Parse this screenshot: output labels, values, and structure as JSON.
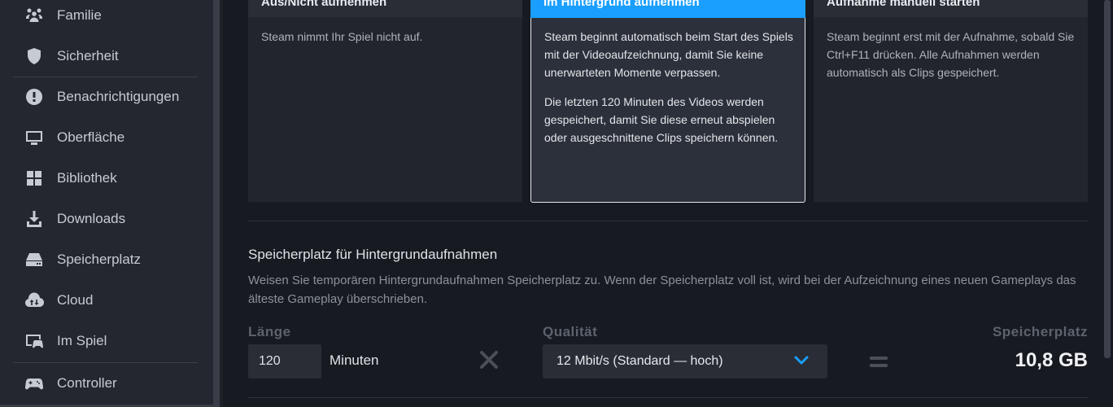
{
  "sidebar": {
    "items": [
      {
        "label": "Familie",
        "icon": "family-icon"
      },
      {
        "label": "Sicherheit",
        "icon": "shield-icon"
      },
      {
        "label": "Benachrichtigungen",
        "icon": "notification-icon"
      },
      {
        "label": "Oberfläche",
        "icon": "monitor-icon"
      },
      {
        "label": "Bibliothek",
        "icon": "library-grid-icon"
      },
      {
        "label": "Downloads",
        "icon": "download-icon"
      },
      {
        "label": "Speicherplatz",
        "icon": "storage-drive-icon"
      },
      {
        "label": "Cloud",
        "icon": "cloud-sync-icon"
      },
      {
        "label": "Im Spiel",
        "icon": "in-game-icon"
      },
      {
        "label": "Controller",
        "icon": "gamepad-icon"
      }
    ]
  },
  "recording_modes": [
    {
      "title": "Aus/Nicht aufnehmen",
      "paragraphs": [
        "Steam nimmt Ihr Spiel nicht auf."
      ],
      "selected": false
    },
    {
      "title": "Im Hintergrund aufnehmen",
      "paragraphs": [
        "Steam beginnt automatisch beim Start des Spiels mit der Videoaufzeichnung, damit Sie keine unerwarteten Momente verpassen.",
        "Die letzten 120 Minuten des Videos werden gespeichert, damit Sie diese erneut abspielen oder ausgeschnittene Clips speichern können."
      ],
      "selected": true
    },
    {
      "title": "Aufnahme manuell starten",
      "paragraphs": [
        "Steam beginnt erst mit der Aufnahme, sobald Sie Ctrl+F11 drücken. Alle Aufnahmen werden automatisch als Clips gespeichert."
      ],
      "selected": false
    }
  ],
  "background_storage": {
    "title": "Speicherplatz für Hintergrundaufnahmen",
    "description": "Weisen Sie temporären Hintergrundaufnahmen Speicherplatz zu. Wenn der Speicherplatz voll ist, wird bei der Aufzeichnung eines neuen Gameplays das älteste Gameplay überschrieben.",
    "length_label": "Länge",
    "length_value": "120",
    "length_unit": "Minuten",
    "quality_label": "Qualität",
    "quality_value": "12 Mbit/s (Standard — hoch)",
    "storage_label": "Speicherplatz",
    "storage_value": "10,8 GB"
  },
  "colors": {
    "accent": "#1a9fff",
    "background": "#171a21",
    "sidebar": "#24272f",
    "card": "#22252d"
  }
}
